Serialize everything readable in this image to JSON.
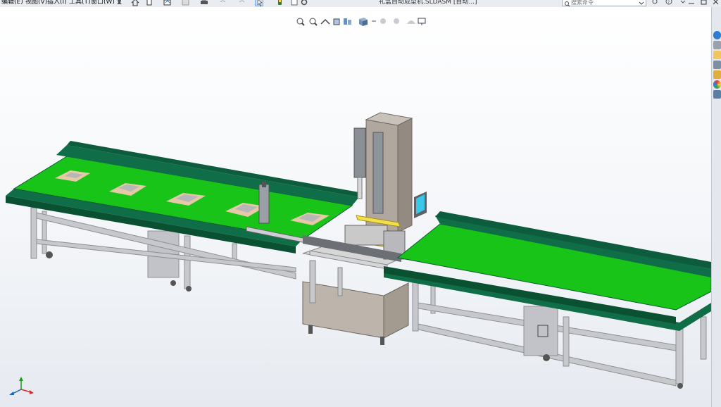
{
  "menu": {
    "items": [
      "编辑(E)",
      "视图(V)",
      "插入(I)",
      "工具(T)",
      "窗口(W)"
    ]
  },
  "title_bar": {
    "document_title": "礼盒自动成型机.SLDASM [自动...]"
  },
  "search": {
    "placeholder": "搜索命令"
  },
  "toolbar_icons": [
    "home-icon",
    "new-doc-icon",
    "open-icon",
    "save-icon",
    "print-icon",
    "undo-icon",
    "select-icon",
    "rebuild-icon",
    "options-icon"
  ],
  "window_controls": [
    "user-icon",
    "help-icon",
    "minimize-icon",
    "restore-icon",
    "close-icon"
  ],
  "heads_up_icons": [
    "zoom-to-fit-icon",
    "zoom-area-icon",
    "previous-view-icon",
    "section-view-icon",
    "view-orientation-icon",
    "display-style-icon",
    "hide-show-icon",
    "edit-appearance-icon",
    "apply-scene-icon",
    "view-settings-icon"
  ],
  "task_pane_icons": [
    "resources-icon",
    "design-library-icon",
    "file-explorer-icon",
    "view-palette-icon",
    "appearances-icon",
    "custom-properties-icon"
  ],
  "colors": {
    "belt_green": "#19c419",
    "belt_edge": "#0f6e47",
    "frame": "#c7c8cc",
    "cabinet": "#bdb4ab",
    "accent_yellow": "#f4e04a"
  }
}
